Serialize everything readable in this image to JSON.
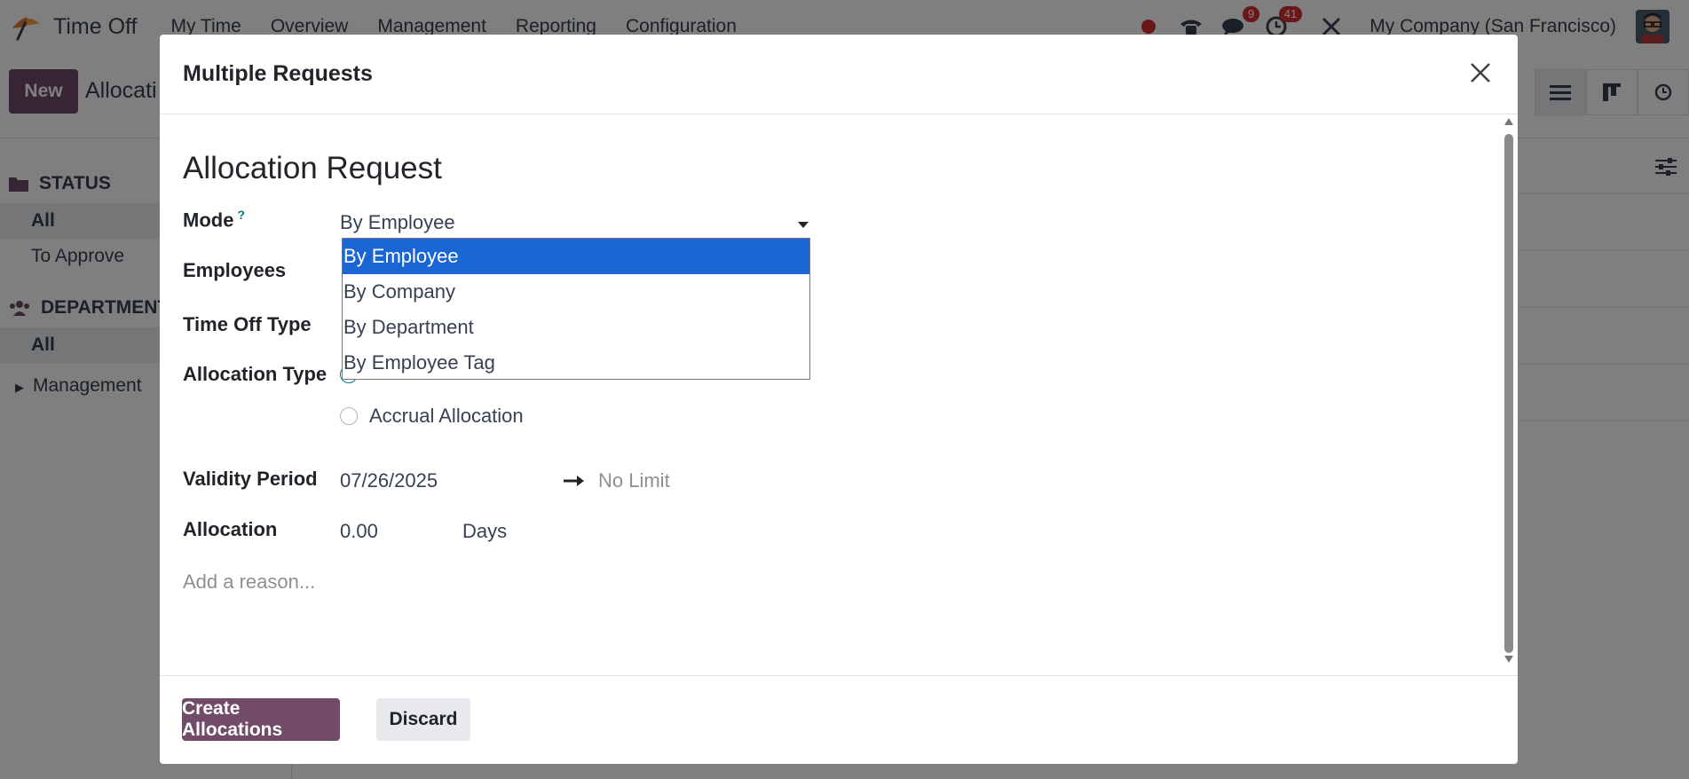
{
  "app": {
    "name": "Time Off",
    "menu": [
      "My Time",
      "Overview",
      "Management",
      "Reporting",
      "Configuration"
    ],
    "chat_badge": "9",
    "activity_badge": "41",
    "company": "My Company (San Francisco)",
    "new_label": "New",
    "breadcrumb": "Allocati"
  },
  "sidebar": {
    "status_title": "STATUS",
    "status_items": [
      "All",
      "To Approve"
    ],
    "department_title": "DEPARTMENT",
    "department_items": [
      "All",
      "Management"
    ]
  },
  "dialog": {
    "title": "Multiple Requests",
    "form_title": "Allocation Request",
    "mode_label": "Mode",
    "mode_help": "?",
    "mode_value": "By Employee",
    "mode_options": [
      "By Employee",
      "By Company",
      "By Department",
      "By Employee Tag"
    ],
    "employees_label": "Employees",
    "time_off_type_label": "Time Off Type",
    "allocation_type_label": "Allocation Type",
    "accrual_option": "Accrual Allocation",
    "validity_label": "Validity Period",
    "validity_start": "07/26/2025",
    "validity_end_placeholder": "No Limit",
    "allocation_label": "Allocation",
    "allocation_value": "0.00",
    "allocation_unit": "Days",
    "reason_placeholder": "Add a reason...",
    "create_button": "Create Allocations",
    "discard_button": "Discard"
  },
  "colors": {
    "primary": "#714b67",
    "selection": "#1a66d4",
    "accent": "#017e84",
    "badge": "#d62e35"
  }
}
